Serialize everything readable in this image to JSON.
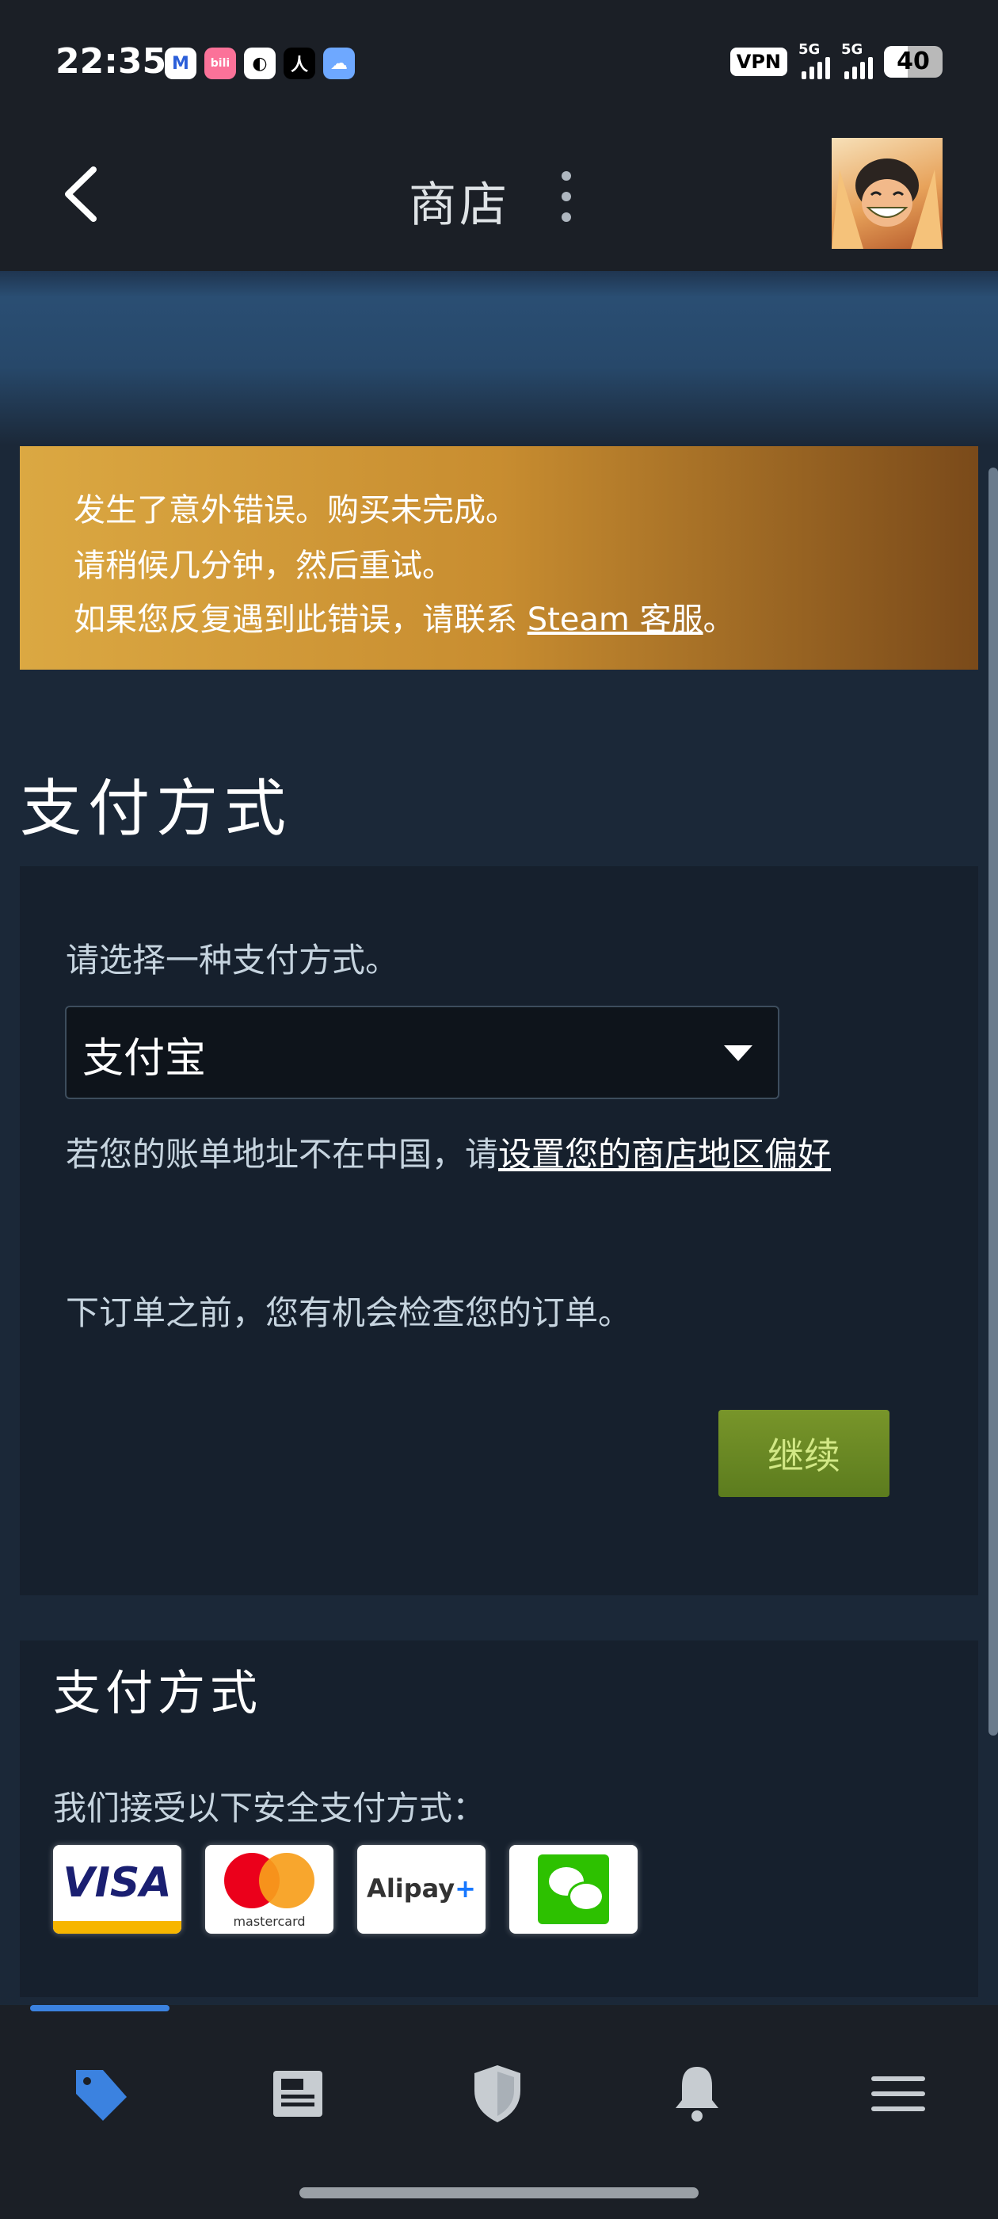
{
  "status_bar": {
    "time": "22:35",
    "apps": [
      "M",
      "bili",
      "◐",
      "人",
      "☁"
    ],
    "vpn": "VPN",
    "net1": "5G",
    "net2": "5G",
    "battery": "40"
  },
  "nav": {
    "title": "商店",
    "back_icon": "back-arrow-icon",
    "more_icon": "more-vertical-icon",
    "avatar": "user-avatar"
  },
  "error": {
    "line1": "发生了意外错误。购买未完成。",
    "line2": "请稍候几分钟，然后重试。",
    "line3_prefix": "如果您反复遇到此错误，请联系 ",
    "line3_link": "Steam 客服",
    "line3_suffix": "。"
  },
  "payment": {
    "heading": "支付方式",
    "prompt": "请选择一种支付方式。",
    "selected_method": "支付宝",
    "region_prefix": "若您的账单地址不在中国，请",
    "region_link": "设置您的商店地区偏好",
    "review_note": "下订单之前，您有机会检查您的订单。",
    "continue_label": "继续"
  },
  "accepted": {
    "heading": "支付方式",
    "note": "我们接受以下安全支付方式：",
    "methods": {
      "visa": "VISA",
      "mastercard": "mastercard",
      "alipay": "Alipay",
      "alipay_plus": "+",
      "wechat": "wechat-pay"
    }
  },
  "tabs": [
    {
      "icon": "store-tag-icon",
      "active": true
    },
    {
      "icon": "news-icon",
      "active": false
    },
    {
      "icon": "shield-icon",
      "active": false
    },
    {
      "icon": "bell-icon",
      "active": false
    },
    {
      "icon": "menu-icon",
      "active": false
    }
  ],
  "colors": {
    "accent": "#3b82e0",
    "error_start": "#dba842",
    "error_end": "#7a4a1a",
    "continue_button": "#6a8a24"
  }
}
